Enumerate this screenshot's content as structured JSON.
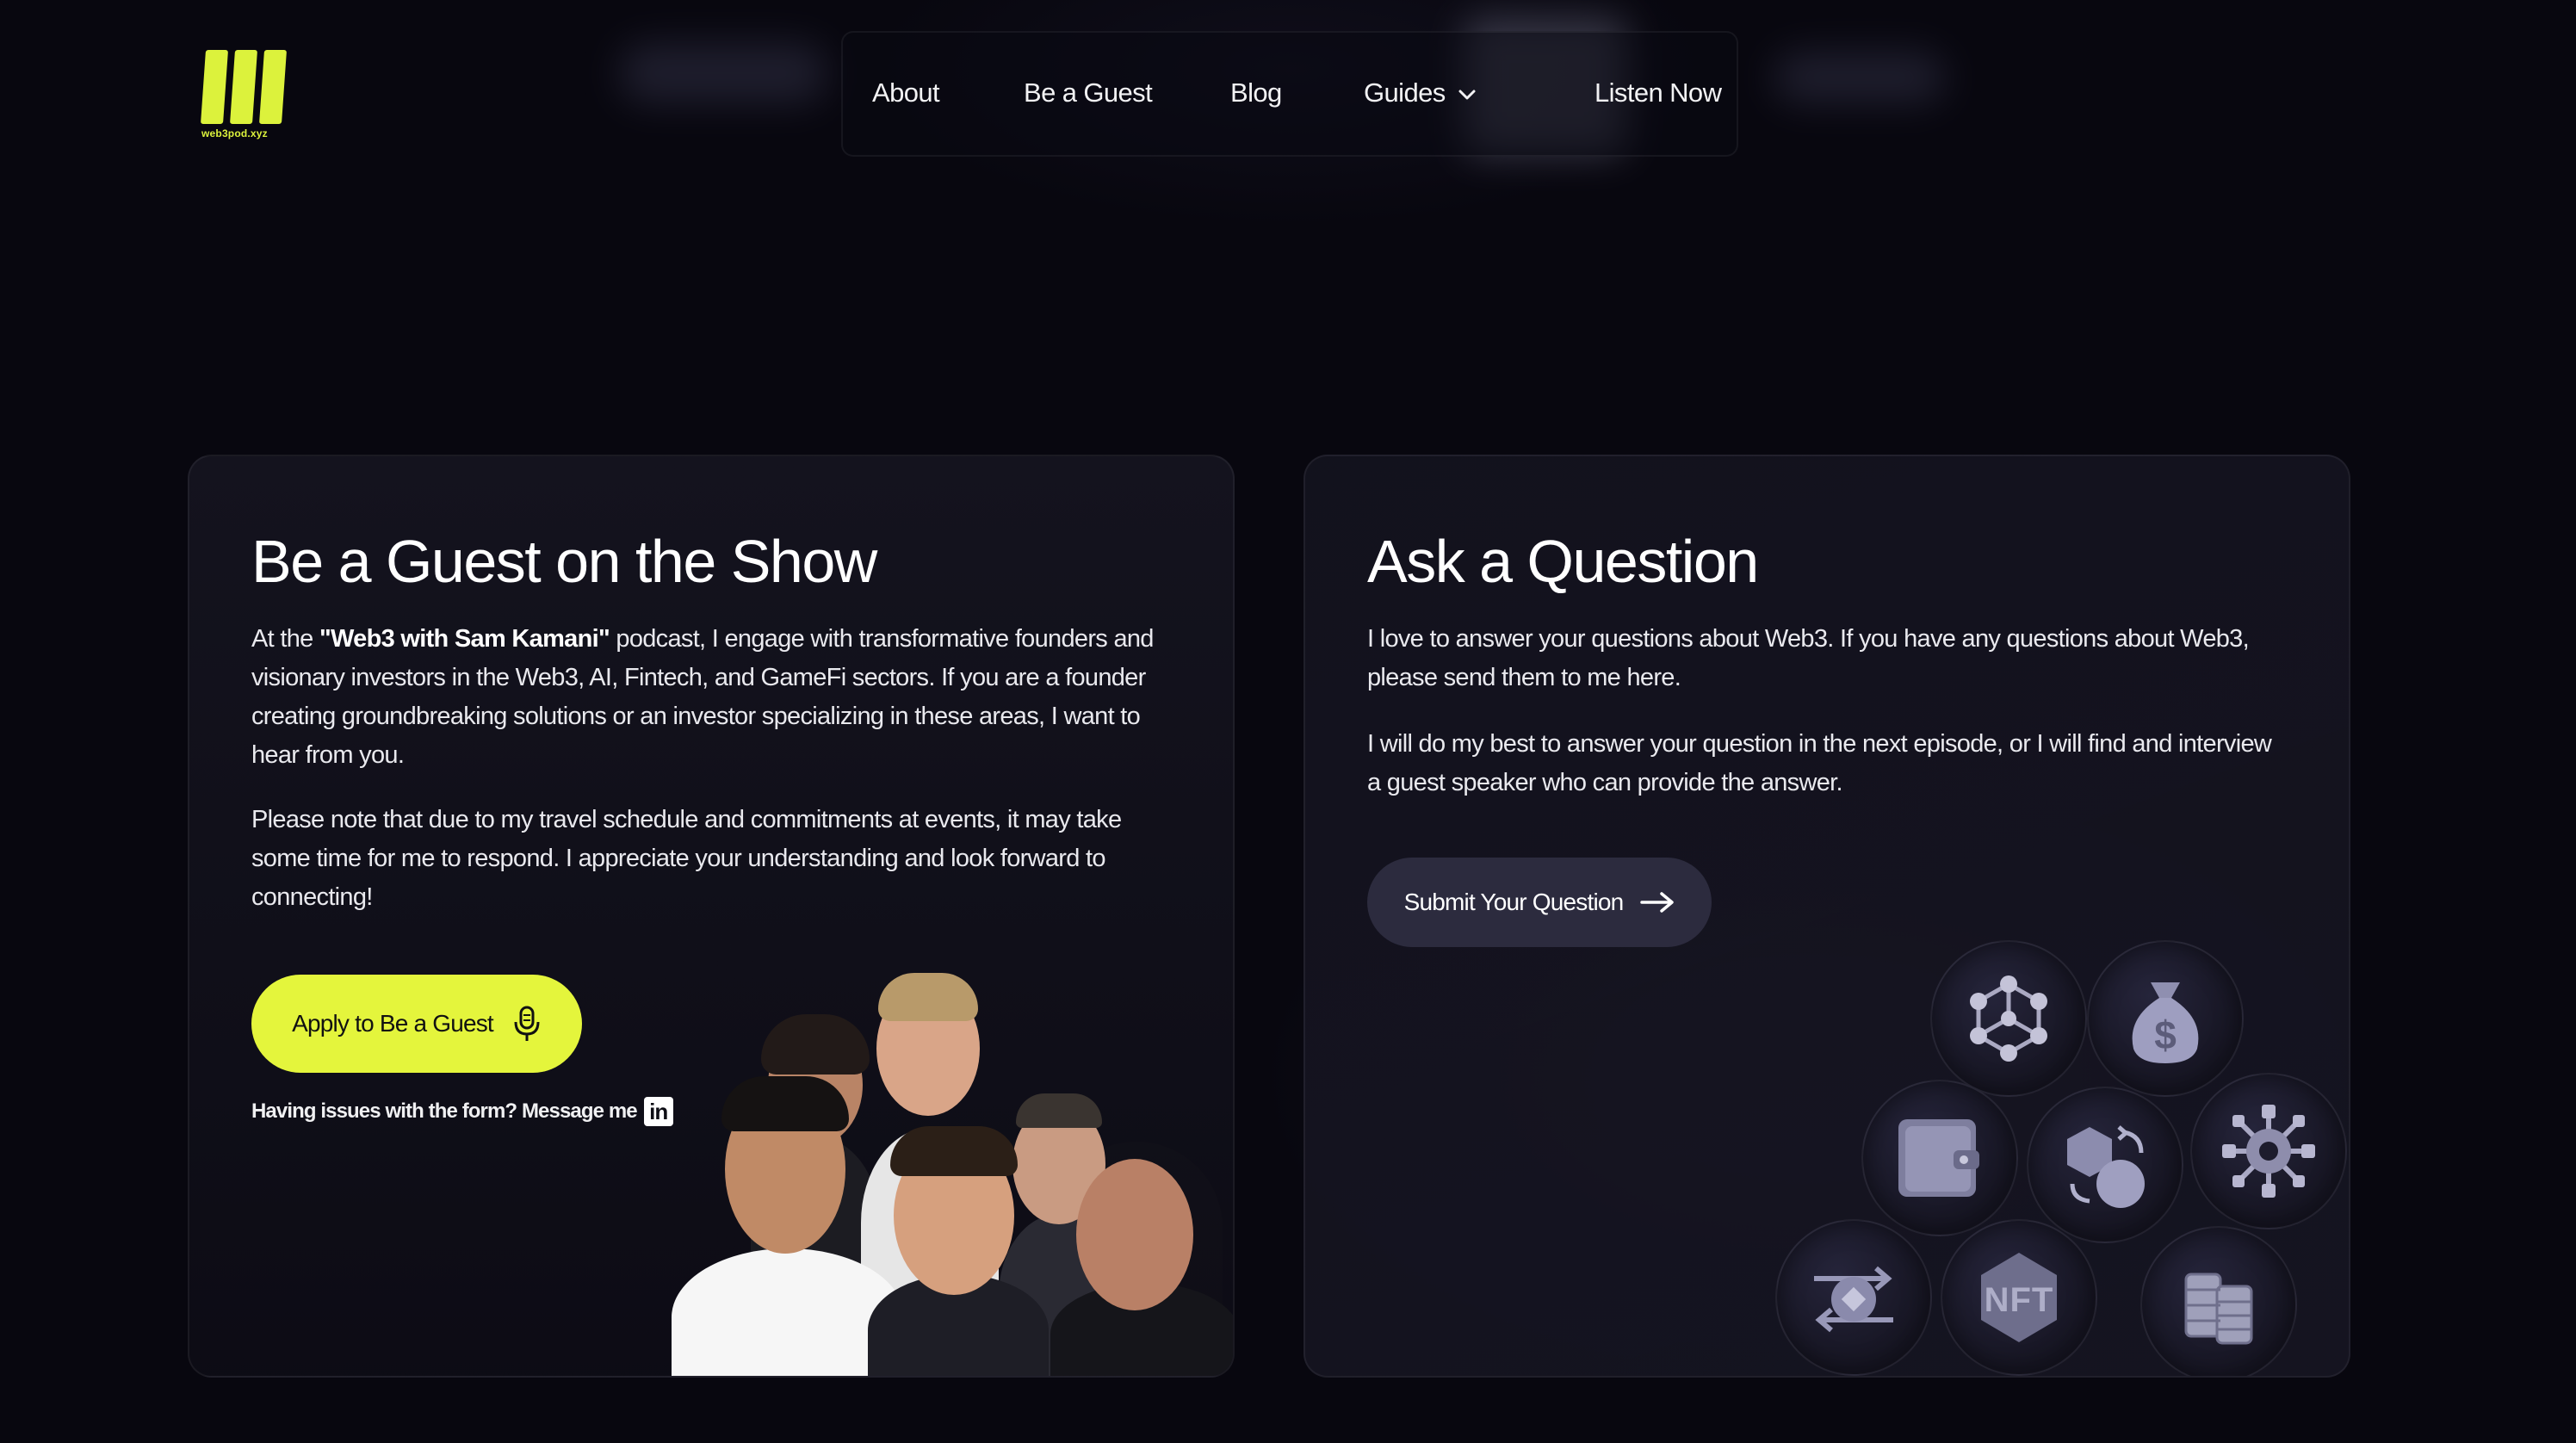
{
  "brand": {
    "logo_text": "web3pod.xyz",
    "accent_color": "#e4f53c"
  },
  "nav": {
    "items": [
      {
        "label": "About"
      },
      {
        "label": "Be a Guest"
      },
      {
        "label": "Blog"
      },
      {
        "label": "Guides"
      },
      {
        "label": "Listen Now"
      }
    ]
  },
  "guest_card": {
    "title": "Be a Guest on the Show",
    "para1_prefix": "At the ",
    "para1_podcast": "\"Web3 with Sam Kamani\"",
    "para1_suffix": " podcast, I engage with transformative founders and visionary investors in the Web3, AI, Fintech, and GameFi sectors. If you are a founder creating groundbreaking solutions or an investor specializing in these areas, I want to hear from you.",
    "para2": "Please note that due to my travel schedule and commitments at events, it may take some time for me to respond. I appreciate your understanding and look forward to connecting!",
    "apply_button": "Apply to Be a Guest",
    "issue_text": "Having issues with the form? Message me",
    "linkedin_label": "in"
  },
  "question_card": {
    "title": "Ask a Question",
    "para1": "I love to answer your questions about Web3. If you have any questions about Web3, please send them to me here.",
    "para2": "I will do my best to answer your question in the next episode, or I will find and interview a guest speaker who can provide the answer.",
    "submit_button": "Submit Your Question",
    "icons": [
      "network-icon",
      "money-bag-icon",
      "wallet-icon",
      "exchange-icon",
      "gear-network-icon",
      "token-swap-icon",
      "nft-icon",
      "coins-icon"
    ],
    "nft_label": "NFT",
    "dollar_label": "$"
  }
}
